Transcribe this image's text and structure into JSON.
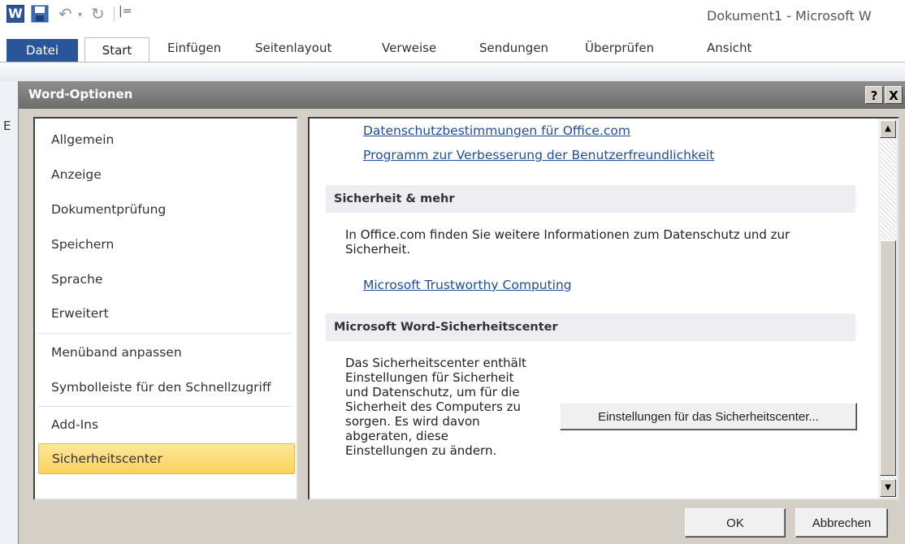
{
  "window": {
    "title": "Dokument1 - Microsoft W",
    "word_logo": "W",
    "qat_customize": "|=",
    "undo_dropdown": "▾"
  },
  "ribbon": {
    "tabs": [
      "Datei",
      "Start",
      "Einfügen",
      "Seitenlayout",
      "Verweise",
      "Sendungen",
      "Überprüfen",
      "Ansicht"
    ],
    "file_tab_color": "#2a5699"
  },
  "document": {
    "edge_letter": "E"
  },
  "dialog": {
    "title": "Word-Optionen",
    "help_label": "?",
    "close_label": "X",
    "nav": {
      "items": [
        "Allgemein",
        "Anzeige",
        "Dokumentprüfung",
        "Speichern",
        "Sprache",
        "Erweitert",
        "Menüband anpassen",
        "Symbolleiste für den Schnellzugriff",
        "Add-Ins",
        "Sicherheitscenter"
      ],
      "selected": "Sicherheitscenter",
      "selected_color": "#f9d25a"
    },
    "content": {
      "link_privacy": "Datenschutzbestimmungen für Office.com",
      "link_ceip": "Programm zur Verbesserung der Benutzerfreundlichkeit",
      "section_security": {
        "header": "Sicherheit & mehr",
        "text_line1": "In Office.com finden Sie weitere Informationen zum Datenschutz und zur",
        "text_line2": "Sicherheit.",
        "link": "Microsoft Trustworthy Computing"
      },
      "section_trust_center": {
        "header": "Microsoft Word-Sicherheitscenter",
        "text_lines": [
          "Das Sicherheitscenter enthält",
          "Einstellungen für Sicherheit",
          "und Datenschutz, um für die",
          "Sicherheit des Computers zu",
          "sorgen. Es wird davon",
          "abgeraten, diese",
          "Einstellungen zu ändern."
        ],
        "button_label": "Einstellungen für das Sicherheitscenter..."
      }
    },
    "scrollbar": {
      "up_icon": "▲",
      "down_icon": "▼"
    },
    "ok_label": "OK",
    "cancel_label": "Abbrechen"
  }
}
